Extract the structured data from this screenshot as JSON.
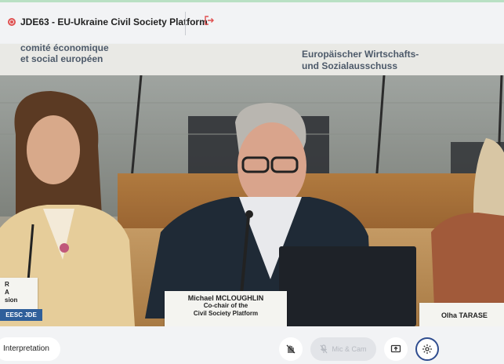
{
  "header": {
    "title": "JDE63 - EU-Ukraine Civil Society Platform"
  },
  "video": {
    "banner_left_line1": "comité économique",
    "banner_left_line2": "et social européen",
    "banner_right_line1": "Europäischer Wirtschafts-",
    "banner_right_line2": "und Sozialausschuss",
    "nameplate_center_name": "Michael MCLOUGHLIN",
    "nameplate_center_role1": "Co-chair of the",
    "nameplate_center_role2": "Civil Society Platform",
    "nameplate_right_name": "Olha TARASE",
    "nameplate_left_line1": "R",
    "nameplate_left_line2": "A",
    "nameplate_left_line3": "sion",
    "watermark": "EESC JDE"
  },
  "toolbar": {
    "interpretation_label": "Interpretation",
    "mic_cam_label": "Mic & Cam"
  },
  "colors": {
    "accent": "#2f4d8f",
    "record": "#e05050"
  }
}
